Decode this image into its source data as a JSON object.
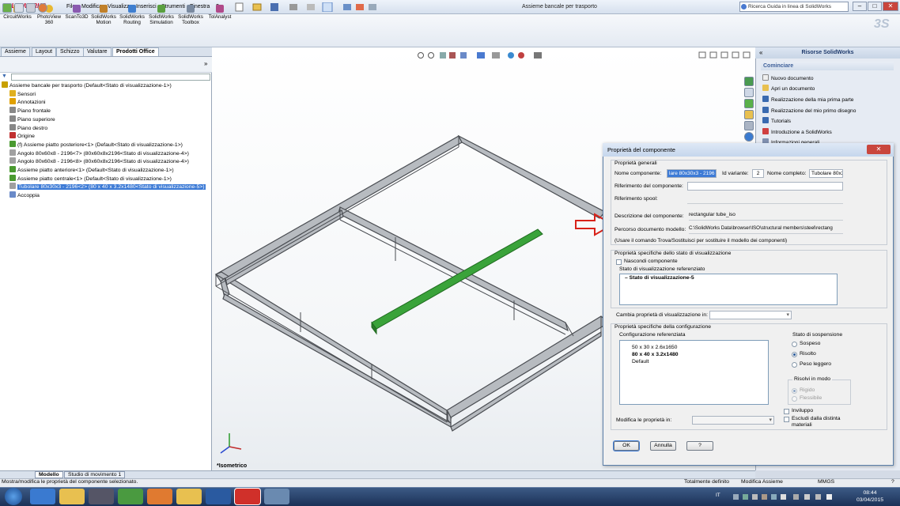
{
  "app": {
    "logo": "SOLIDWORKS",
    "window_title": "Assieme bancale per trasporto",
    "menu": [
      "File",
      "Modifica",
      "Visualizza",
      "Inserisci",
      "Strumenti",
      "Finestra",
      "?"
    ],
    "search_placeholder": "Ricerca Guida in linea di SolidWorks"
  },
  "ribbon": {
    "buttons": [
      "CircuitWorks",
      "PhotoView 360",
      "ScanTo3D",
      "SolidWorks Motion",
      "SolidWorks Routing",
      "SolidWorks Simulation",
      "SolidWorks Toolbox",
      "TolAnalyst"
    ]
  },
  "left_tabs": [
    "Assieme",
    "Layout",
    "Schizzo",
    "Valutare",
    "Prodotti Office"
  ],
  "tree": [
    {
      "label": "Assieme bancale per trasporto  (Default<Stato di visualizzazione-1>)",
      "indent": 0,
      "color": "#c8a000"
    },
    {
      "label": "Sensori",
      "indent": 1,
      "color": "#e0b020"
    },
    {
      "label": "Annotazioni",
      "indent": 1,
      "color": "#e0a000"
    },
    {
      "label": "Piano frontale",
      "indent": 1,
      "color": "#888888"
    },
    {
      "label": "Piano superiore",
      "indent": 1,
      "color": "#888888"
    },
    {
      "label": "Piano destro",
      "indent": 1,
      "color": "#888888"
    },
    {
      "label": "Origine",
      "indent": 1,
      "color": "#c03030"
    },
    {
      "label": "(f) Assieme piatto posteriore<1> (Default<Stato di visualizzazione-1>)",
      "indent": 1,
      "color": "#4a9a30"
    },
    {
      "label": "Angolo 80x60x8 - 2196<7> (80x60x8x2196<Stato di visualizzazione-4>)",
      "indent": 1,
      "color": "#a0a0a0"
    },
    {
      "label": "Angolo 80x60x8 - 2196<8> (80x60x8x2196<Stato di visualizzazione-4>)",
      "indent": 1,
      "color": "#a0a0a0"
    },
    {
      "label": "Assieme piatto anteriore<1> (Default<Stato di visualizzazione-1>)",
      "indent": 1,
      "color": "#4a9a30"
    },
    {
      "label": "Assieme piatto centrale<1> (Default<Stato di visualizzazione-1>)",
      "indent": 1,
      "color": "#4a9a30"
    },
    {
      "label": "Tubolare 80x30x3 - 2196<2> (80 x 40 x 3.2x1480<Stato di visualizzazione-5>)",
      "indent": 1,
      "color": "#a0a0a0",
      "selected": true
    },
    {
      "label": "Accoppia",
      "indent": 1,
      "color": "#6a8ac8"
    }
  ],
  "viewport": {
    "view_label": "*Isometrico"
  },
  "right_panel": {
    "title": "Risorse SolidWorks",
    "section": "Cominciare",
    "links": [
      "Nuovo documento",
      "Apri un documento",
      "Realizzazione della mia prima parte",
      "Realizzazione del mio primo disegno",
      "Tutorials",
      "Introduzione a SolidWorks",
      "Informazioni generali"
    ]
  },
  "dialog": {
    "title": "Proprietà del componente",
    "general_group": "Proprietà generali",
    "component_name_label": "Nome componente:",
    "component_name": "lare 80x30x3 - 2196",
    "instance_id_label": "Id variante:",
    "instance_id": "2",
    "full_name_label": "Nome completo:",
    "full_name": "Tubolare 80x3",
    "component_ref_label": "Riferimento del componente:",
    "spool_ref_label": "Riferimento spool:",
    "description_label": "Descrizione del componente:",
    "description": "rectangular tube_iso",
    "path_label": "Percorso documento modello:",
    "path": "C:\\SolidWorks Data\\browser\\ISO\\structural members\\steel\\rectang",
    "path_note": "(Usare il comando Trova/Sostituisci per sostituire il modello dei componenti)",
    "display_group": "Proprietà specifiche dello stato di visualizzazione",
    "hide_component": "Nascondi componente",
    "ref_display_state_label": "Stato di visualizzazione referenziato",
    "display_states": [
      "Stato di visualizzazione-5"
    ],
    "change_display_label": "Cambia proprietà di visualizzazione in:",
    "config_group": "Proprietà specifiche della configurazione",
    "ref_config_label": "Configurazione referenziata",
    "configs": [
      "50 x 30 x 2.6x1650",
      "80 x 40 x 3.2x1480",
      "Default"
    ],
    "selected_config": "80 x 40 x 3.2x1480",
    "suppression_label": "Stato di sospensione",
    "suppression_options": [
      "Sospeso",
      "Risolto",
      "Peso leggero"
    ],
    "suppression_selected": "Risolto",
    "solve_as_label": "Risolvi in modo",
    "solve_options": [
      "Rigido",
      "Flessibile"
    ],
    "envelope": "Inviluppo",
    "exclude_bom": "Escludi dalla distinta materiali",
    "modify_label": "Modifica le proprietà in:",
    "ok": "OK",
    "cancel": "Annulla",
    "help": "?"
  },
  "bottom_tabs": [
    "Modello",
    "Studio di movimento 1"
  ],
  "status": {
    "message": "Mostra/modifica le proprietà del componente selezionato.",
    "defined": "Totalmente definito",
    "mode": "Modifica Assieme",
    "units": "MMGS",
    "help": "?"
  },
  "taskbar": {
    "lang": "IT",
    "time": "08:44",
    "date": "03/04/2015"
  },
  "colors": {
    "selected_part": "#3aa33a",
    "frame": "#8c9096",
    "highlight": "#3d7bd6",
    "arrow": "#d8231a"
  }
}
